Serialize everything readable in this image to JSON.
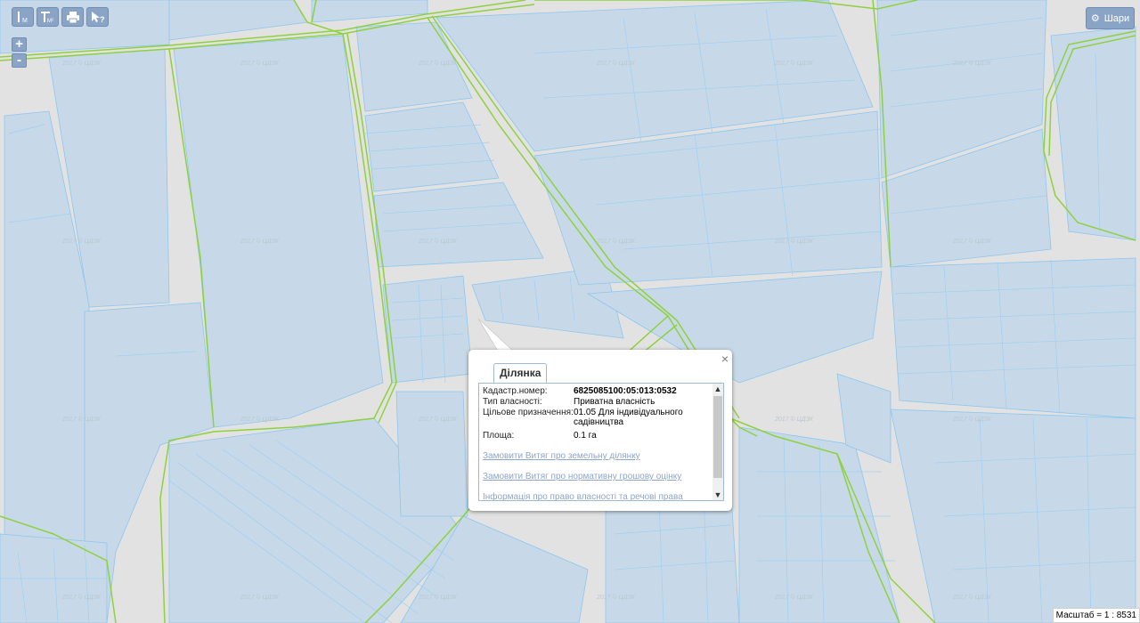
{
  "map": {
    "watermark": "2017 © ЦДЗК",
    "colors": {
      "background": "#e2e2e2",
      "parcel_fill": "#c7d9e8",
      "parcel_border": "#8cc6f0",
      "road_line": "#8fd13d"
    }
  },
  "toolbar": {
    "measure_line_label": "M",
    "measure_area_label": "M²",
    "identify_label": "?"
  },
  "zoom": {
    "in_label": "+",
    "out_label": "-"
  },
  "layers_button": {
    "label": "Шари"
  },
  "popup": {
    "tab_label": "Ділянка",
    "close_label": "×",
    "fields": [
      {
        "label": "Кадастр.номер:",
        "value": "6825085100:05:013:0532"
      },
      {
        "label": "Тип власності:",
        "value": "Приватна власність"
      },
      {
        "label": "Цільове призначення:",
        "value": "01.05 Для індивідуального садівництва"
      },
      {
        "label": "Площа:",
        "value": "0.1 га"
      }
    ],
    "links": [
      "Замовити Витяг про земельну ділянку",
      "Замовити Витяг про нормативну грошову оцінку",
      "Інформація про право власності та речові права"
    ]
  },
  "scale": {
    "label": "Масштаб = 1 : 8531"
  }
}
